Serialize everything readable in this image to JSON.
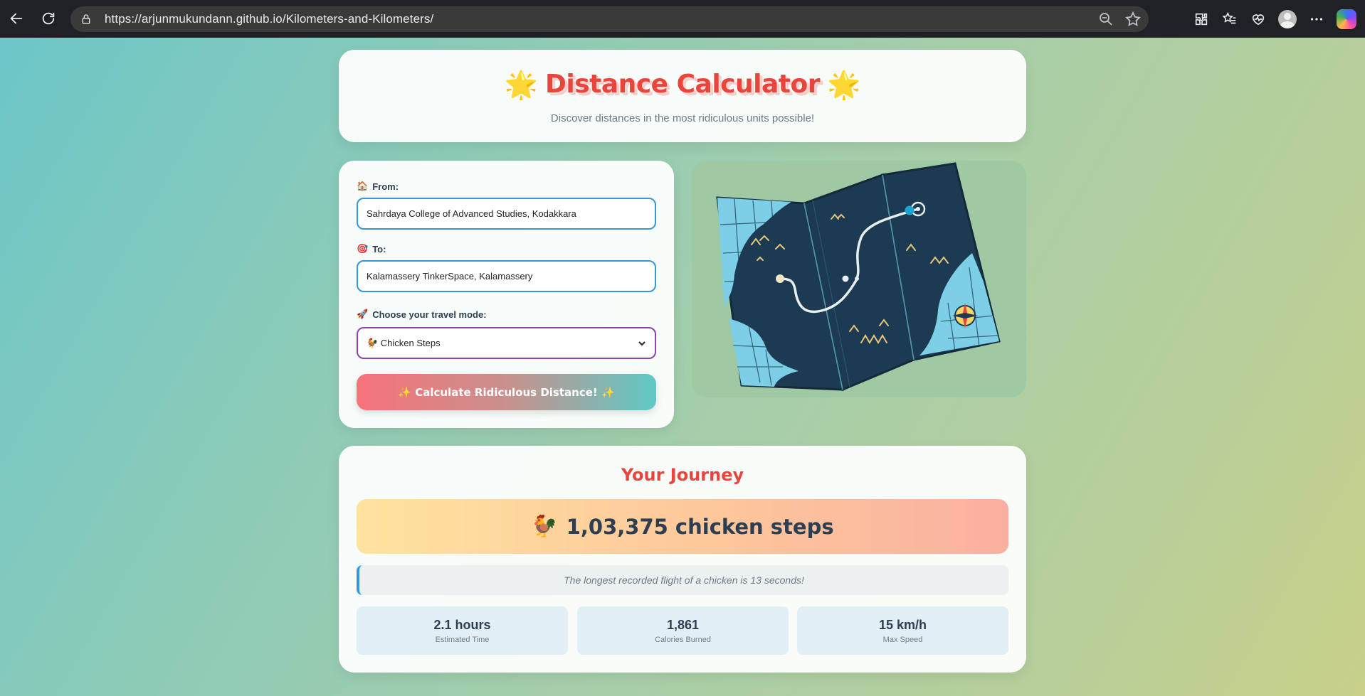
{
  "browser": {
    "url": "https://arjunmukundann.github.io/Kilometers-and-Kilometers/"
  },
  "header": {
    "title": "Distance Calculator",
    "star_emoji": "🌟",
    "subtitle": "Discover distances in the most ridiculous units possible!"
  },
  "form": {
    "from_label": "From:",
    "from_emoji": "🏠",
    "from_value": "Sahrdaya College of Advanced Studies, Kodakkara",
    "to_label": "To:",
    "to_emoji": "🎯",
    "to_value": "Kalamassery TinkerSpace, Kalamassery",
    "mode_label": "Choose your travel mode:",
    "mode_emoji": "🚀",
    "mode_value": "🐓 Chicken Steps",
    "calculate_label": "✨ Calculate Ridiculous Distance! ✨"
  },
  "result": {
    "title": "Your Journey",
    "emoji": "🐓",
    "distance_text": "1,03,375 chicken steps",
    "fact": "The longest recorded flight of a chicken is 13 seconds!",
    "stats": [
      {
        "value": "2.1 hours",
        "label": "Estimated Time"
      },
      {
        "value": "1,861",
        "label": "Calories Burned"
      },
      {
        "value": "15 km/h",
        "label": "Max Speed"
      }
    ]
  },
  "colors": {
    "accent_red": "#e8453c",
    "text_dark": "#2c3e50",
    "input_border": "#3498db",
    "select_border": "#8e44ad"
  }
}
